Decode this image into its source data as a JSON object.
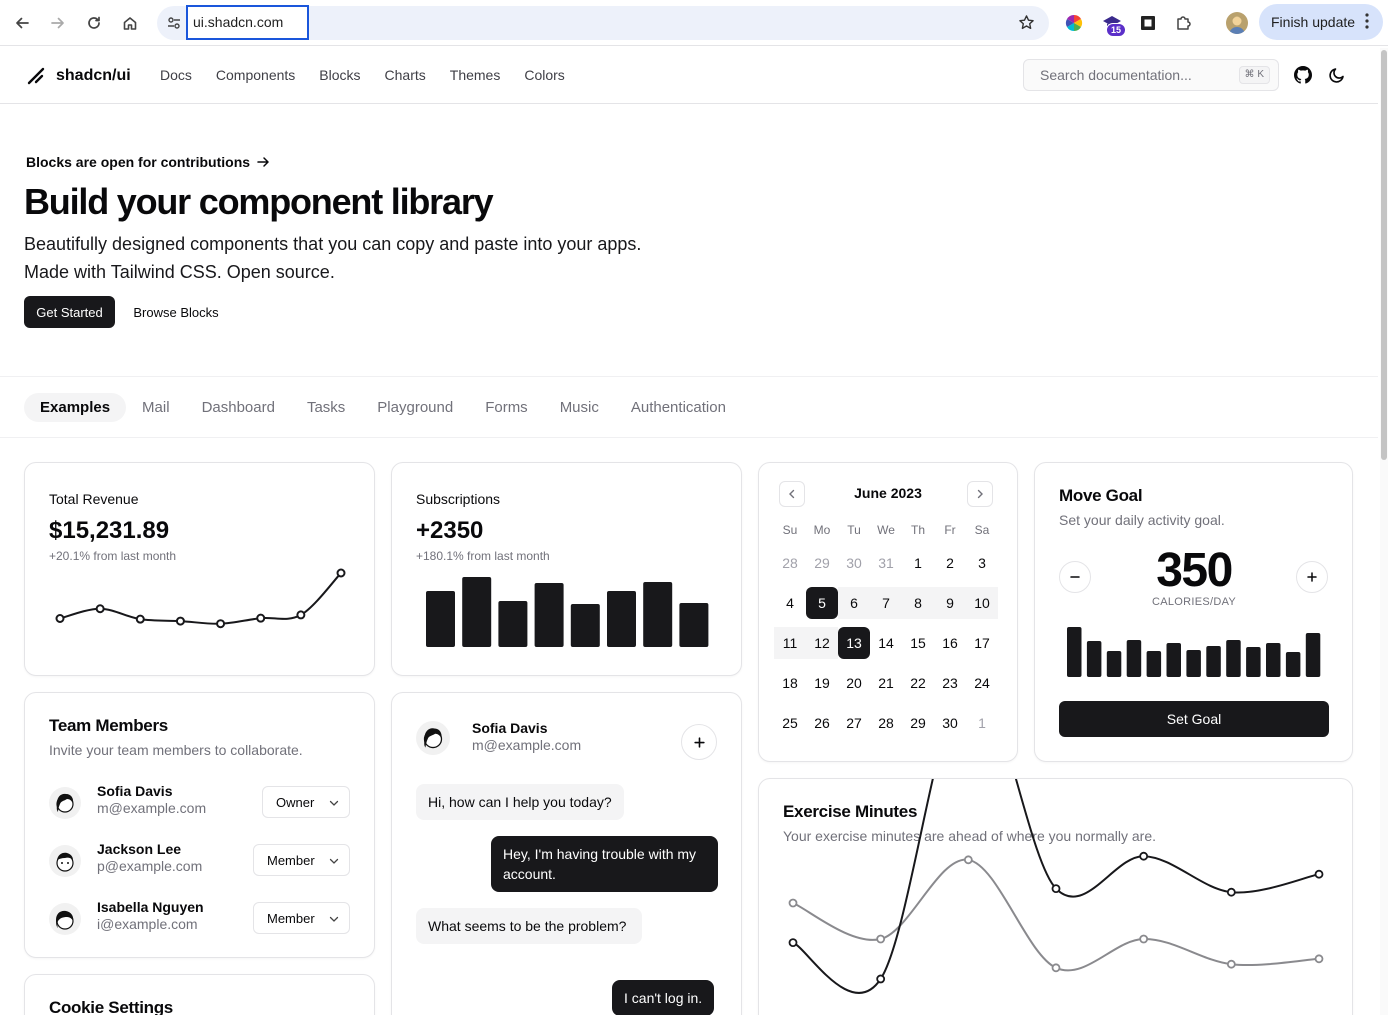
{
  "browser": {
    "url": "ui.shadcn.com",
    "extension_badge": "15",
    "finish_update_label": "Finish update"
  },
  "site": {
    "brand": "shadcn/ui",
    "nav": [
      "Docs",
      "Components",
      "Blocks",
      "Charts",
      "Themes",
      "Colors"
    ],
    "search_placeholder": "Search documentation...",
    "search_shortcut": "⌘ K"
  },
  "hero": {
    "announcement": "Blocks are open for contributions",
    "title": "Build your component library",
    "subtitle_line1": "Beautifully designed components that you can copy and paste into your apps.",
    "subtitle_line2": "Made with Tailwind CSS. Open source.",
    "primary_button": "Get Started",
    "secondary_button": "Browse Blocks"
  },
  "example_tabs": [
    "Examples",
    "Mail",
    "Dashboard",
    "Tasks",
    "Playground",
    "Forms",
    "Music",
    "Authentication"
  ],
  "revenue": {
    "label": "Total Revenue",
    "value": "$15,231.89",
    "change": "+20.1% from last month",
    "chart_data": {
      "type": "line",
      "values": [
        7,
        10,
        6.8,
        6.2,
        5.4,
        7.1,
        8.1,
        21
      ]
    }
  },
  "subscriptions": {
    "label": "Subscriptions",
    "value": "+2350",
    "change": "+180.1% from last month",
    "chart_data": {
      "type": "bar",
      "values": [
        56,
        70,
        46,
        64,
        43,
        56,
        65,
        44
      ]
    }
  },
  "calendar": {
    "month": "June 2023",
    "weekdays": [
      "Su",
      "Mo",
      "Tu",
      "We",
      "Th",
      "Fr",
      "Sa"
    ],
    "weeks": [
      [
        "28",
        "29",
        "30",
        "31",
        "1",
        "2",
        "3"
      ],
      [
        "4",
        "5",
        "6",
        "7",
        "8",
        "9",
        "10"
      ],
      [
        "11",
        "12",
        "13",
        "14",
        "15",
        "16",
        "17"
      ],
      [
        "18",
        "19",
        "20",
        "21",
        "22",
        "23",
        "24"
      ],
      [
        "25",
        "26",
        "27",
        "28",
        "29",
        "30",
        "1"
      ]
    ],
    "selected": [
      "5",
      "13"
    ]
  },
  "move_goal": {
    "title": "Move Goal",
    "description": "Set your daily activity goal.",
    "value": "350",
    "unit": "CALORIES/DAY",
    "button": "Set Goal",
    "chart_data": {
      "type": "bar",
      "values": [
        50,
        36,
        26,
        37,
        26,
        34,
        27,
        31,
        37,
        30,
        34,
        25,
        44
      ]
    }
  },
  "team": {
    "title": "Team Members",
    "description": "Invite your team members to collaborate.",
    "members": [
      {
        "name": "Sofia Davis",
        "email": "m@example.com",
        "role": "Owner"
      },
      {
        "name": "Jackson Lee",
        "email": "p@example.com",
        "role": "Member"
      },
      {
        "name": "Isabella Nguyen",
        "email": "i@example.com",
        "role": "Member"
      }
    ]
  },
  "chat": {
    "name": "Sofia Davis",
    "email": "m@example.com",
    "messages": [
      {
        "from": "agent",
        "text": "Hi, how can I help you today?"
      },
      {
        "from": "user",
        "text": "Hey, I'm having trouble with my account."
      },
      {
        "from": "agent",
        "text": "What seems to be the problem?"
      },
      {
        "from": "user",
        "text": "I can't log in."
      }
    ]
  },
  "cookie": {
    "title": "Cookie Settings"
  },
  "exercise": {
    "title": "Exercise Minutes",
    "description": "Your exercise minutes are ahead of where you normally are.",
    "chart_data": {
      "type": "line",
      "series": [
        {
          "values": [
            400,
            300,
            520,
            220,
            300,
            230,
            245
          ]
        },
        {
          "values": [
            240,
            139,
            980,
            390,
            480,
            380,
            430
          ]
        }
      ]
    }
  },
  "colors": {
    "accent": "#18181b",
    "muted": "#71717a",
    "border": "#e4e4e7",
    "url_focus": "#1a56db"
  }
}
